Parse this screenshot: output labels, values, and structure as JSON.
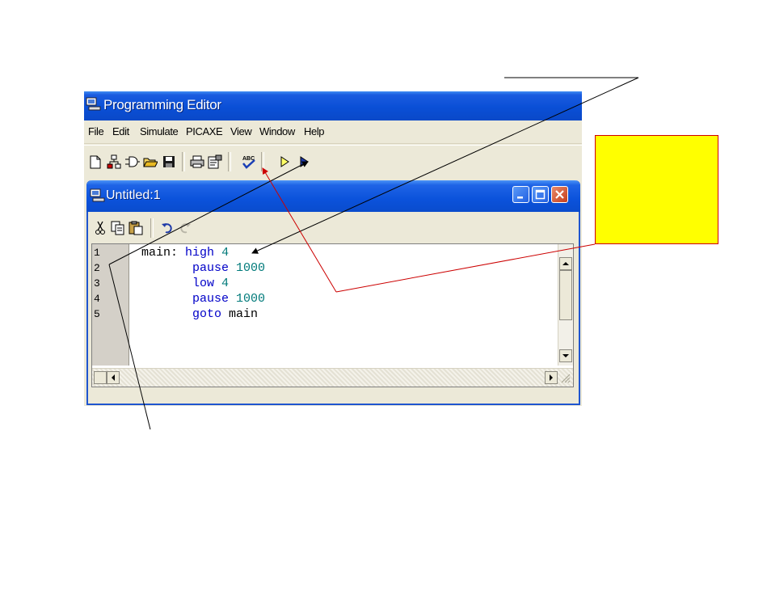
{
  "app": {
    "title": "Programming Editor",
    "menu": [
      "File",
      "Edit",
      "Simulate",
      "PICAXE",
      "View",
      "Window",
      "Help"
    ],
    "toolbar_icons": [
      "new-file-icon",
      "flowchart-icon",
      "logic-gate-icon",
      "open-folder-icon",
      "save-disk-icon",
      "print-icon",
      "properties-icon",
      "syntax-check-icon",
      "simulate-icon",
      "program-icon"
    ]
  },
  "child_window": {
    "title": "Untitled:1",
    "toolbar_icons": [
      "cut-icon",
      "copy-icon",
      "paste-icon",
      "undo-icon",
      "redo-icon"
    ]
  },
  "editor": {
    "line_numbers": [
      "1",
      "2",
      "3",
      "4",
      "5"
    ],
    "code": [
      {
        "label": "main:",
        "keyword": "high",
        "arg": "4"
      },
      {
        "label": "",
        "keyword": "pause",
        "arg": "1000"
      },
      {
        "label": "",
        "keyword": "low",
        "arg": "4"
      },
      {
        "label": "",
        "keyword": "pause",
        "arg": "1000"
      },
      {
        "label": "",
        "keyword": "goto",
        "arg": "main"
      }
    ]
  },
  "annotation": {
    "callout_color": "#ffff00",
    "callout_border": "#d00000",
    "arrow_colors": [
      "#000000",
      "#cc0000"
    ]
  }
}
